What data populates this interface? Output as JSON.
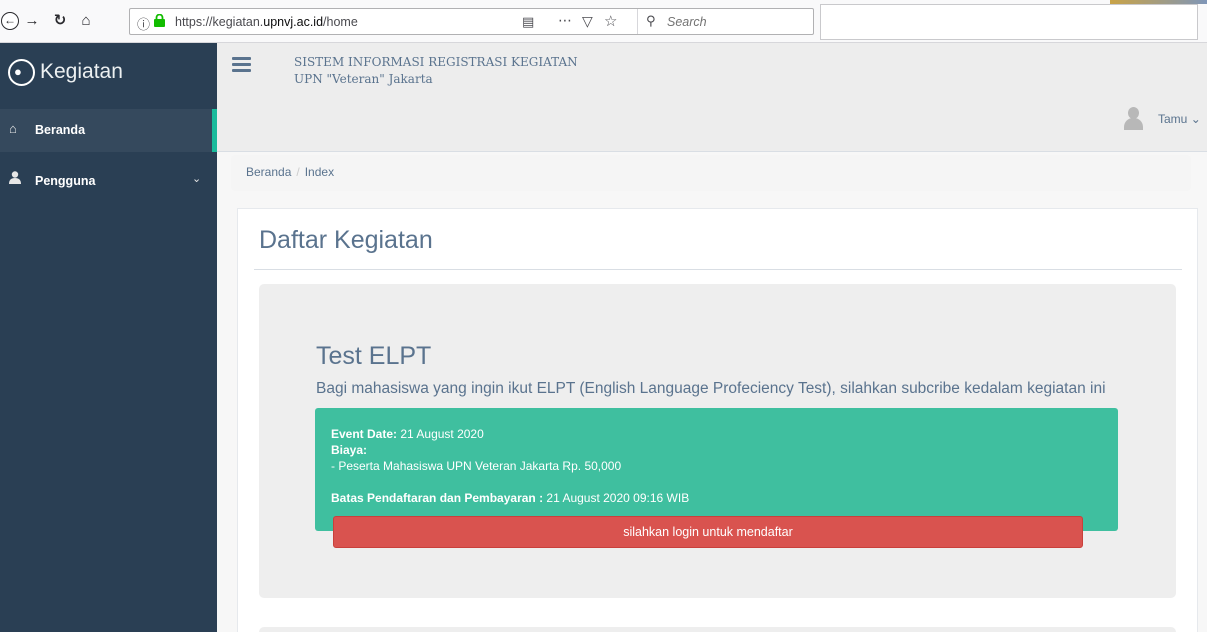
{
  "browser": {
    "url_prefix": "https://kegiatan.",
    "url_domain": "upnvj.ac.id",
    "url_path": "/home",
    "search_placeholder": "Search"
  },
  "sidebar": {
    "brand": "Kegiatan",
    "items": [
      {
        "label": "Beranda",
        "icon": "home-icon",
        "active": true
      },
      {
        "label": "Pengguna",
        "icon": "user-icon",
        "has_submenu": true
      }
    ]
  },
  "header": {
    "system_title_line1": "SISTEM INFORMASI REGISTRASI KEGIATAN",
    "system_title_line2": "UPN \"Veteran\" Jakarta",
    "user_name": "Tamu"
  },
  "breadcrumb": {
    "home": "Beranda",
    "current": "Index"
  },
  "main": {
    "title": "Daftar Kegiatan",
    "events": [
      {
        "title": "Test ELPT",
        "description": "Bagi mahasiswa yang ingin ikut ELPT (English Language Profeciency Test), silahkan subcribe kedalam kegiatan ini",
        "event_date_label": "Event Date:",
        "event_date": "21 August 2020",
        "cost_label": "Biaya:",
        "cost_item": "- Peserta Mahasiswa UPN Veteran Jakarta Rp. 50,000",
        "deadline_label": "Batas Pendaftaran dan Pembayaran :",
        "deadline": "21 August 2020 09:16 WIB",
        "button_label": "silahkan login untuk mendaftar"
      }
    ]
  },
  "colors": {
    "sidebar_bg": "#2a3f54",
    "accent": "#1abb9c",
    "info_box": "#3fbf9f",
    "button_danger": "#d9534f",
    "text_primary": "#5a738e"
  }
}
